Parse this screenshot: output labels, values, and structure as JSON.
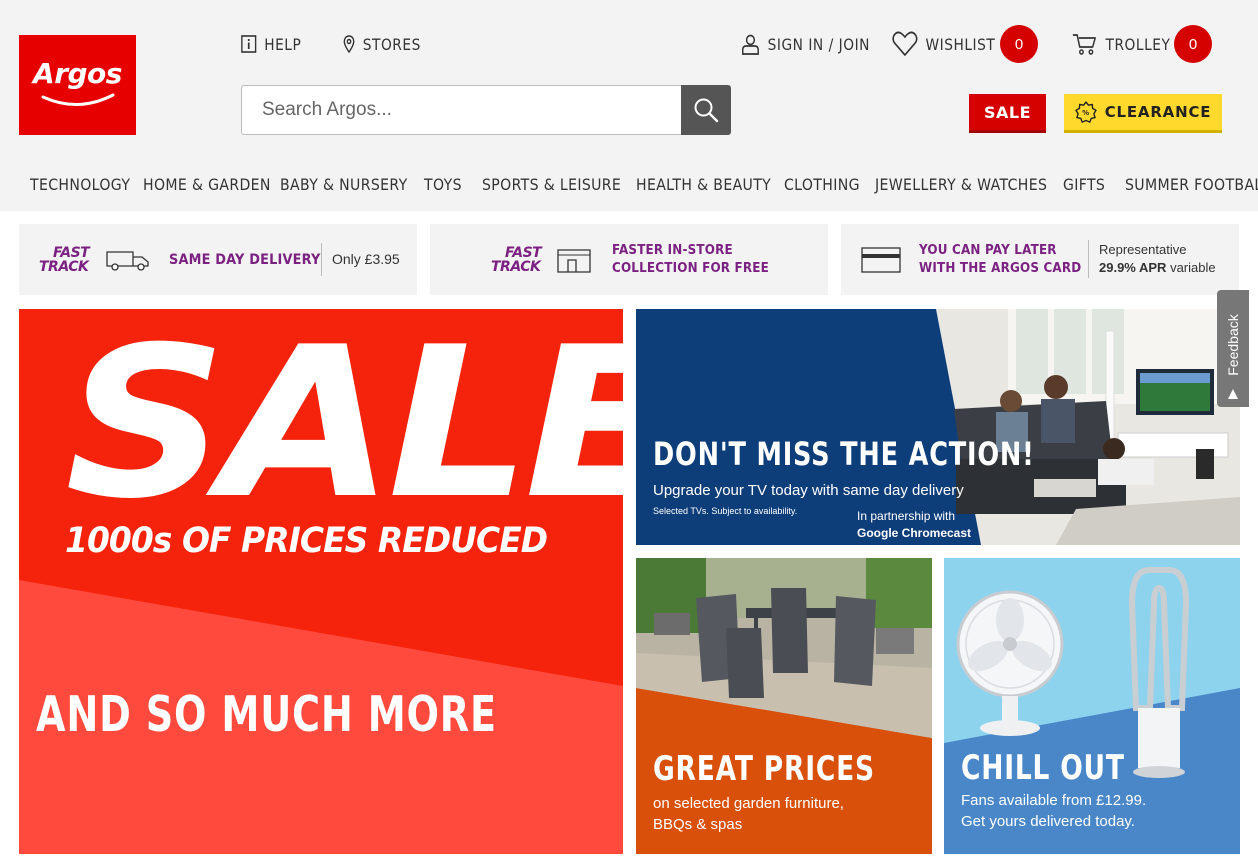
{
  "header": {
    "logo_text": "Argos",
    "help": "HELP",
    "stores": "STORES",
    "sign_in": "SIGN IN / JOIN",
    "wishlist": "WISHLIST",
    "wishlist_count": "0",
    "trolley": "TROLLEY",
    "trolley_count": "0",
    "search_placeholder": "Search Argos...",
    "sale": "SALE",
    "clearance": "CLEARANCE"
  },
  "nav": [
    "TECHNOLOGY",
    "HOME & GARDEN",
    "BABY & NURSERY",
    "TOYS",
    "SPORTS & LEISURE",
    "HEALTH & BEAUTY",
    "CLOTHING",
    "JEWELLERY & WATCHES",
    "GIFTS",
    "SUMMER FOOTBALL"
  ],
  "benefits": {
    "fast_track_line1": "FAST",
    "fast_track_line2": "TRACK",
    "delivery_title": "SAME DAY DELIVERY",
    "delivery_price": "Only £3.95",
    "collection_line1": "FASTER IN-STORE",
    "collection_line2": "COLLECTION FOR FREE",
    "card_line1": "YOU CAN PAY LATER",
    "card_line2": "WITH THE ARGOS CARD",
    "apr_line1": "Representative",
    "apr_rate": "29.9% APR",
    "apr_variable": "variable"
  },
  "hero": {
    "sale_word": "SALE",
    "sale_sub": "1000s OF PRICES REDUCED",
    "sale_more": "AND SO MUCH MORE"
  },
  "tv_promo": {
    "heading": "DON'T MISS THE ACTION!",
    "text": "Upgrade your TV today with same day delivery",
    "small": "Selected TVs. Subject to availability.",
    "partner_line1": "In partnership with",
    "partner_line2": "Google Chromecast"
  },
  "garden_promo": {
    "heading": "GREAT PRICES",
    "line1": "on selected garden furniture,",
    "line2": "BBQs & spas"
  },
  "fan_promo": {
    "heading": "CHILL OUT",
    "line1": "Fans available from £12.99.",
    "line2": "Get yours delivered today."
  },
  "feedback": "Feedback",
  "colors": {
    "brand_red": "#e60000",
    "purple": "#7b2182",
    "clearance_yellow": "#ffd92b",
    "tv_blue": "#0e3e7a",
    "garden_orange": "#d8500a",
    "fan_blue": "#4a87c9"
  }
}
